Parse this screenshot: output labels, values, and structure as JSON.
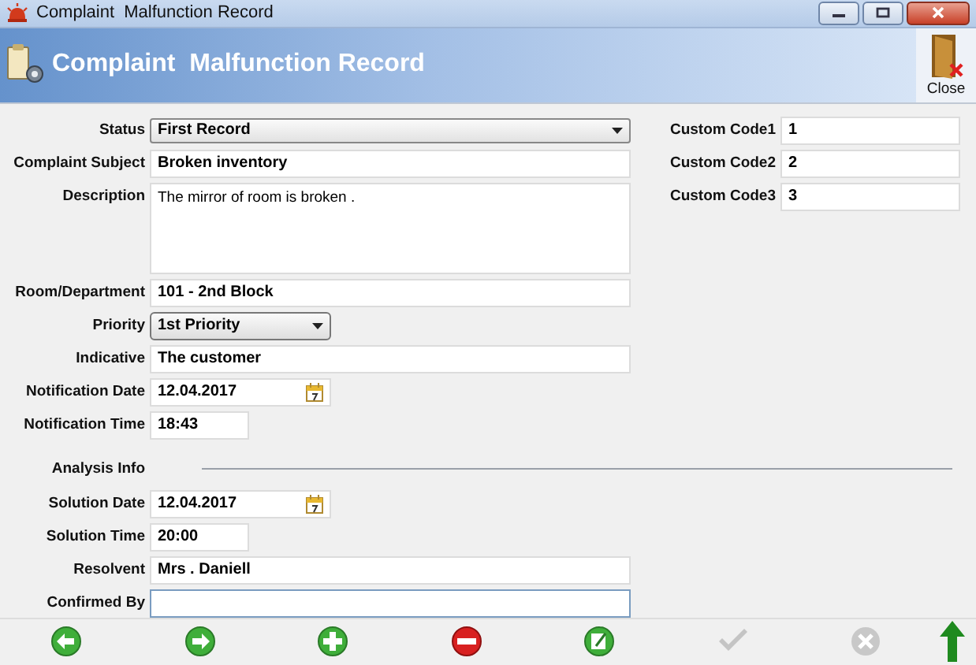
{
  "window": {
    "title": "Complaint  Malfunction Record"
  },
  "header": {
    "title": "Complaint  Malfunction Record",
    "close_label": "Close"
  },
  "fields": [
    {
      "label": "Status",
      "value": "First Record",
      "kind": "select",
      "focused": false
    },
    {
      "label": "Complaint Subject",
      "value": "Broken inventory",
      "kind": "text",
      "focused": false
    },
    {
      "label": "Description",
      "value": "The mirror of room is broken .",
      "kind": "textarea",
      "focused": false
    },
    {
      "label": "Room/Department",
      "value": "101 - 2nd Block",
      "kind": "text",
      "focused": false
    },
    {
      "label": "Priority",
      "value": "1st Priority",
      "kind": "short-select",
      "focused": false
    },
    {
      "label": "Indicative",
      "value": "The customer",
      "kind": "text",
      "focused": false
    },
    {
      "label": "Notification Date",
      "value": "12.04.2017",
      "kind": "date",
      "focused": false
    },
    {
      "label": "Notification Time",
      "value": "18:43",
      "kind": "time",
      "focused": false
    }
  ],
  "custom_codes": [
    {
      "label": "Custom Code1",
      "value": "1"
    },
    {
      "label": "Custom Code2",
      "value": "2"
    },
    {
      "label": "Custom Code3",
      "value": "3"
    }
  ],
  "analysis": {
    "title": "Analysis Info",
    "fields": [
      {
        "label": "Solution Date",
        "value": "12.04.2017",
        "kind": "date",
        "focused": false
      },
      {
        "label": "Solution Time",
        "value": "20:00",
        "kind": "time",
        "focused": false
      },
      {
        "label": "Resolvent",
        "value": "Mrs . Daniell",
        "kind": "text",
        "focused": false
      },
      {
        "label": "Confirmed By",
        "kind": "text",
        "focused": true
      }
    ]
  },
  "toolbar": [
    {
      "kind": "back",
      "disabled": false
    },
    {
      "kind": "forward",
      "disabled": false
    },
    {
      "kind": "add",
      "disabled": false
    },
    {
      "kind": "remove",
      "disabled": false
    },
    {
      "kind": "edit",
      "disabled": false
    },
    {
      "kind": "confirm",
      "disabled": true
    },
    {
      "kind": "cancel",
      "disabled": true
    },
    {
      "kind": "up",
      "disabled": false
    }
  ]
}
